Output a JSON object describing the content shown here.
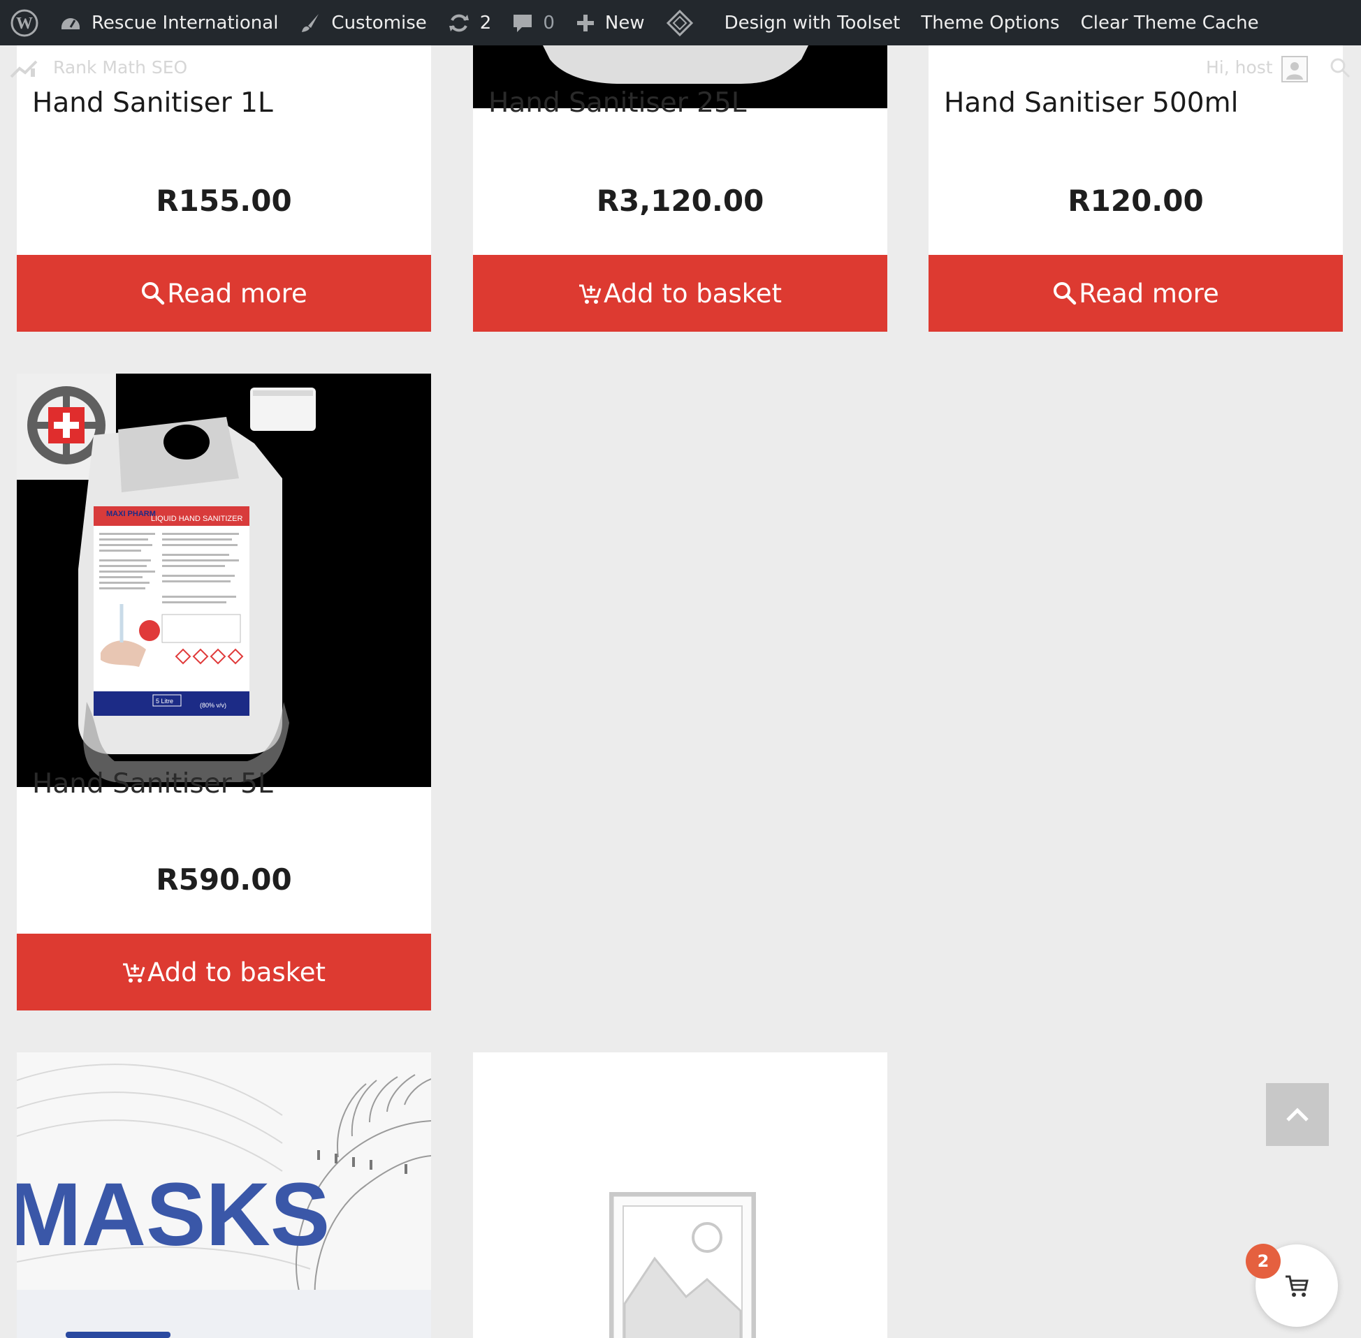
{
  "admin_bar": {
    "site_name": "Rescue International",
    "customise": "Customise",
    "updates_count": "2",
    "comments_count": "0",
    "new_label": "New",
    "toolset_label": "Design with Toolset",
    "theme_options": "Theme Options",
    "clear_cache": "Clear Theme Cache"
  },
  "ghost_bar": {
    "rank_math": "Rank Math SEO",
    "greeting": "Hi, host"
  },
  "products": [
    {
      "title": "Hand Sanitiser 1L",
      "price": "R155.00",
      "button": "Read more",
      "button_icon": "search-icon"
    },
    {
      "title": "Hand Sanitiser 25L",
      "price": "R3,120.00",
      "button": "Add to basket",
      "button_icon": "cart-add-icon"
    },
    {
      "title": "Hand Sanitiser 500ml",
      "price": "R120.00",
      "button": "Read more",
      "button_icon": "search-icon"
    },
    {
      "title": "Hand Sanitiser 5L",
      "price": "R590.00",
      "button": "Add to basket",
      "button_icon": "cart-add-icon",
      "label_brand": "MAXI PHARM",
      "label_title": "LIQUID HAND SANITIZER",
      "label_volume": "5 Litre",
      "label_strength": "(80% v/v)"
    },
    {
      "title": "",
      "image_text": "MASKS"
    },
    {
      "title": "",
      "image": "placeholder-image-icon"
    }
  ],
  "cart": {
    "count": "2"
  },
  "colors": {
    "accent": "#dd3a31",
    "adminbar": "#23282d",
    "badge": "#e5603f",
    "page_bg": "#ececec"
  }
}
